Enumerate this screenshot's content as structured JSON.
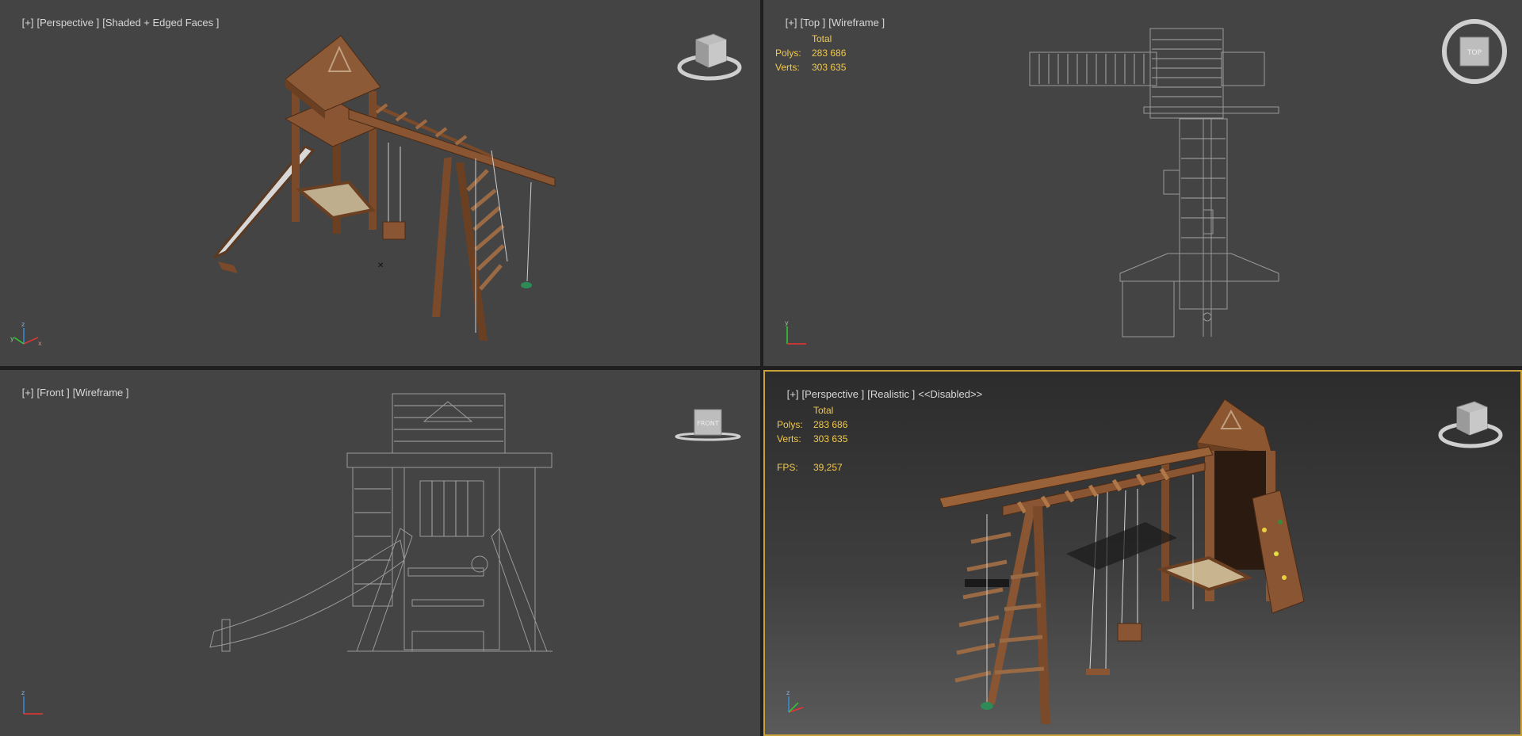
{
  "viewports": {
    "top_left": {
      "label_parts": [
        "[+]",
        "[Perspective ]",
        "[Shaded + Edged Faces ]"
      ],
      "viewcube_label": ""
    },
    "top_right": {
      "label_parts": [
        "[+]",
        "[Top ]",
        "[Wireframe ]"
      ],
      "stats": {
        "total_label": "Total",
        "polys_label": "Polys:",
        "polys_value": "283 686",
        "verts_label": "Verts:",
        "verts_value": "303 635"
      },
      "viewcube_label": "TOP"
    },
    "bottom_left": {
      "label_parts": [
        "[+]",
        "[Front ]",
        "[Wireframe ]"
      ],
      "viewcube_label": "FRONT"
    },
    "bottom_right": {
      "label_parts": [
        "[+]",
        "[Perspective ]",
        "[Realistic ]",
        "<<Disabled>>"
      ],
      "stats": {
        "total_label": "Total",
        "polys_label": "Polys:",
        "polys_value": "283 686",
        "verts_label": "Verts:",
        "verts_value": "303 635",
        "fps_label": "FPS:",
        "fps_value": "39,257"
      },
      "viewcube_label": ""
    }
  },
  "colors": {
    "viewport_bg": "#444444",
    "active_border": "#c9a23a",
    "stats_text": "#f2c94c",
    "label_text": "#d8d8d8",
    "wood": "#7a4a2a",
    "wireframe": "#9a9a9a"
  },
  "icons": [
    "viewcube-icon",
    "axis-tripod-icon"
  ]
}
